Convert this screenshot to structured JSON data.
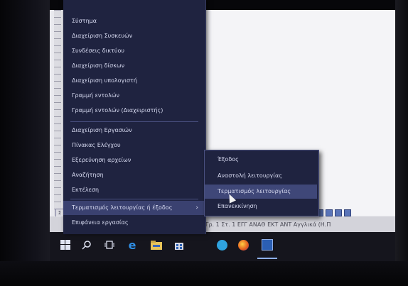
{
  "winx_menu": {
    "items": [
      {
        "label": "Σύστημα"
      },
      {
        "label": "Διαχείριση Συσκευών"
      },
      {
        "label": "Συνδέσεις δικτύου"
      },
      {
        "label": "Διαχείριση δίσκων"
      },
      {
        "label": "Διαχείριση υπολογιστή"
      },
      {
        "label": "Γραμμή εντολών"
      },
      {
        "label": "Γραμμή εντολών (Διαχειριστής)"
      },
      {
        "label": "Διαχείριση Εργασιών"
      },
      {
        "label": "Πίνακας Ελέγχου"
      },
      {
        "label": "Εξερεύνηση αρχείων"
      },
      {
        "label": "Αναζήτηση"
      },
      {
        "label": "Εκτέλεση"
      },
      {
        "label": "Τερματισμός λειτουργίας ή έξοδος"
      },
      {
        "label": "Επιφάνεια εργασίας"
      }
    ]
  },
  "shutdown_submenu": {
    "items": [
      {
        "label": "Έξοδος"
      },
      {
        "label": "Αναστολή λειτουργίας"
      },
      {
        "label": "Τερματισμός λειτουργίας"
      },
      {
        "label": "Επανεκκίνηση"
      }
    ]
  },
  "status_bar": {
    "text": "Γρ. 1   Στ. 1     ΕΓΓ  ΑΝΑΘ  ΕΚΤ  ΑΝΤ  Αγγλικά (Η.Π"
  },
  "taskbar": {
    "icons": [
      "windows-logo-icon",
      "search-icon",
      "task-view-icon",
      "edge-icon",
      "file-explorer-icon",
      "store-icon",
      "skype-icon",
      "firefox-icon",
      "word-icon"
    ]
  },
  "colors": {
    "menu_bg": "#1f2340",
    "menu_highlight": "#3a4170",
    "menu_text": "#d7daf0"
  }
}
